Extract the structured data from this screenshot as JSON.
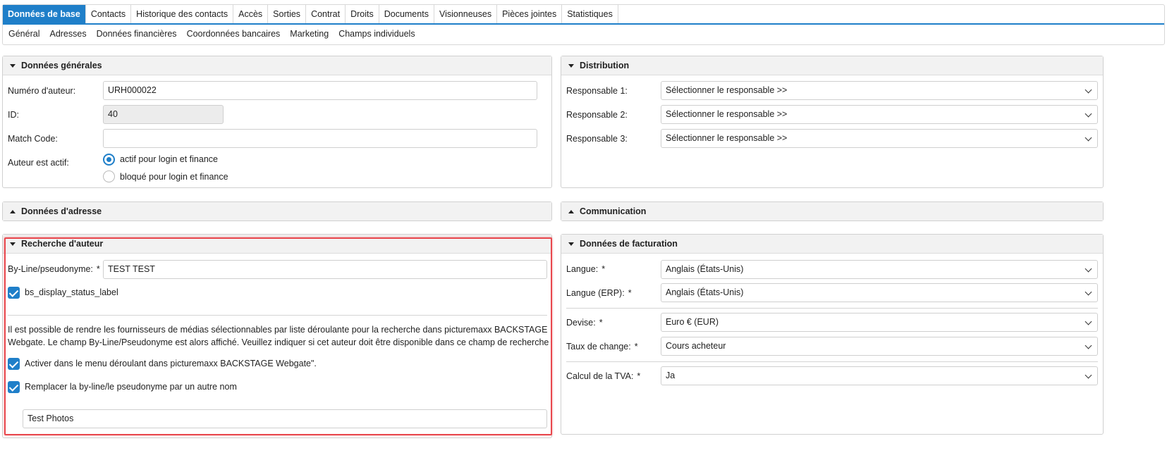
{
  "tabs": [
    "Données de base",
    "Contacts",
    "Historique des contacts",
    "Accès",
    "Sorties",
    "Contrat",
    "Droits",
    "Documents",
    "Visionneuses",
    "Pièces jointes",
    "Statistiques"
  ],
  "subtabs": [
    "Général",
    "Adresses",
    "Données financières",
    "Coordonnées bancaires",
    "Marketing",
    "Champs individuels"
  ],
  "general": {
    "title": "Données générales",
    "author_number_label": "Numéro d'auteur:",
    "author_number_value": "URH000022",
    "id_label": "ID:",
    "id_value": "40",
    "match_code_label": "Match Code:",
    "match_code_value": "",
    "active_label": "Auteur est actif:",
    "radio_active": "actif pour login et finance",
    "radio_blocked": "bloqué pour login et finance"
  },
  "distribution": {
    "title": "Distribution",
    "resp1_label": "Responsable 1:",
    "resp2_label": "Responsable 2:",
    "resp3_label": "Responsable 3:",
    "placeholder": "Sélectionner le responsable >>"
  },
  "address": {
    "title": "Données d'adresse"
  },
  "communication": {
    "title": "Communication"
  },
  "search": {
    "title": "Recherche d'auteur",
    "byline_label": "By-Line/pseudonyme:",
    "required": "*",
    "byline_value": "TEST TEST",
    "status_label": "bs_display_status_label",
    "info_line1": "Il est possible de rendre les fournisseurs de médias sélectionnables par liste déroulante pour la recherche dans picturemaxx BACKSTAGE",
    "info_line2": "Webgate. Le champ By-Line/Pseudonyme est alors affiché. Veuillez indiquer si cet auteur doit être disponible dans ce champ de recherche",
    "activate_label": "Activer dans le menu déroulant dans picturemaxx BACKSTAGE Webgate\".",
    "replace_label": "Remplacer la by-line/le pseudonyme par un autre nom",
    "replacement_value": "Test Photos"
  },
  "billing": {
    "title": "Données de facturation",
    "required": "*",
    "language_label": "Langue:",
    "language_value": "Anglais (États-Unis)",
    "language_erp_label": "Langue (ERP):",
    "language_erp_value": "Anglais (États-Unis)",
    "currency_label": "Devise:",
    "currency_value": "Euro € (EUR)",
    "exchange_label": "Taux de change:",
    "exchange_value": "Cours acheteur",
    "vat_label": "Calcul de la TVA:",
    "vat_value": "Ja"
  },
  "colors": {
    "accent": "#1f7fc9",
    "highlight": "#e8474d",
    "header_bg": "#f2f2f2"
  }
}
